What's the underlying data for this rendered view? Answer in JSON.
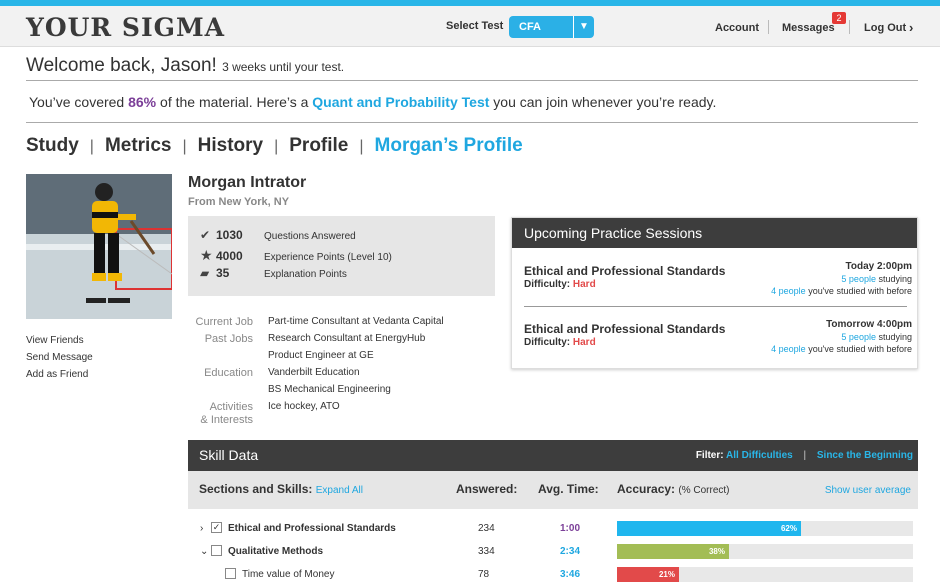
{
  "brand": {
    "logo": "YOUR SIGMA",
    "accent": "#29b6e8",
    "purple": "#7b3f98",
    "red": "#e24a4a",
    "green": "#a3bd55"
  },
  "header": {
    "select_test_label": "Select Test",
    "test_value": "CFA",
    "account": "Account",
    "messages": "Messages",
    "messages_count": "2",
    "logout": "Log Out",
    "chevron": "›"
  },
  "welcome": {
    "text": "Welcome back, Jason!",
    "sub": "3 weeks until your test."
  },
  "covered": {
    "pre": "You’ve covered ",
    "pct": "86%",
    "mid": " of the material. Here’s a ",
    "link": "Quant and Probability Test",
    "post": " you can join whenever you’re ready."
  },
  "mainnav": [
    "Study",
    "Metrics",
    "History",
    "Profile",
    "Morgan’s Profile"
  ],
  "mainnav_sep": "|",
  "left_links": [
    "View Friends",
    "Send Message",
    "Add as Friend"
  ],
  "profile": {
    "name": "Morgan Intrator",
    "location": "From New York, NY",
    "stats": [
      {
        "icon": "check-circle-icon",
        "glyph": "✔",
        "value": "1030",
        "label": "Questions Answered"
      },
      {
        "icon": "star-icon",
        "glyph": "★",
        "value": "4000",
        "label": "Experience Points (Level 10)"
      },
      {
        "icon": "speech-bubble-icon",
        "glyph": "▰",
        "value": "35",
        "label": "Explanation Points"
      }
    ],
    "info": [
      {
        "label": "Current Job",
        "values": [
          "Part-time Consultant at Vedanta Capital"
        ]
      },
      {
        "label": "Past Jobs",
        "values": [
          "Research Consultant at EnergyHub",
          "Product Engineer at GE"
        ]
      },
      {
        "label": "Education",
        "values": [
          "Vanderbilt Education",
          "BS Mechanical Engineering"
        ]
      },
      {
        "label": "Activities",
        "label2": "& Interests",
        "values": [
          "Ice hockey, ATO"
        ]
      }
    ]
  },
  "upcoming": {
    "title": "Upcoming Practice Sessions",
    "sessions": [
      {
        "title": "Ethical and Professional Standards",
        "diff_label": "Difficulty: ",
        "diff": "Hard",
        "when": "Today 2:00pm",
        "studying_n": "5 people",
        "studying_txt": " studying",
        "with_n": "4 people",
        "with_txt": " you've studied with before"
      },
      {
        "title": "Ethical and Professional Standards",
        "diff_label": "Difficulty: ",
        "diff": "Hard",
        "when": "Tomorrow 4:00pm",
        "studying_n": "5 people",
        "studying_txt": " studying",
        "with_n": "4 people",
        "with_txt": " you've studied with before"
      }
    ]
  },
  "skill": {
    "title": "Skill Data",
    "filter_label": "Filter:",
    "filter_difficulty": "All Difficulties",
    "filter_sep": "|",
    "filter_time": "Since the Beginning",
    "col_sections": "Sections and Skills:",
    "expand_all": "Expand All",
    "col_answered": "Answered:",
    "col_time": "Avg. Time:",
    "col_accuracy": "Accuracy:",
    "col_accuracy_sub": "(% Correct)",
    "show_avg": "Show user average",
    "rows": [
      {
        "name": "Ethical and Professional Standards",
        "chevron": "›",
        "checked": true,
        "answered": "234",
        "time": "1:00",
        "time_color": "#7b3f98",
        "accuracy": 62,
        "accuracy_label": "62%",
        "color": "#1fb6ee",
        "indent": 0
      },
      {
        "name": "Qualitative Methods",
        "chevron": "⌄",
        "checked": false,
        "answered": "334",
        "time": "2:34",
        "time_color": "#1fa7e0",
        "accuracy": 38,
        "accuracy_label": "38%",
        "color": "#a3bd55",
        "indent": 0
      },
      {
        "name": "Time value of Money",
        "chevron": "",
        "checked": false,
        "answered": "78",
        "time": "3:46",
        "time_color": "#1fa7e0",
        "accuracy": 21,
        "accuracy_label": "21%",
        "color": "#e24a4a",
        "indent": 1
      }
    ]
  }
}
